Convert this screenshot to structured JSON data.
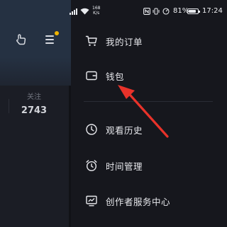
{
  "status_bar": {
    "network_speed_value": "168",
    "network_speed_unit": "K/s",
    "battery_percent": "81%",
    "battery_level": 0.81,
    "time": "17:24",
    "icons": [
      "signal-icon",
      "wifi-icon",
      "nfc-icon",
      "vibrate-icon",
      "data-saver-icon",
      "battery-icon"
    ]
  },
  "background_page": {
    "follow_label": "关注",
    "follow_count": "2743",
    "notification_dot_color": "#f0b400"
  },
  "drawer": {
    "items": [
      {
        "label": "我的订单",
        "icon": "cart-icon"
      },
      {
        "label": "钱包",
        "icon": "wallet-icon"
      },
      {
        "label": "观看历史",
        "icon": "clock-icon"
      },
      {
        "label": "时间管理",
        "icon": "alarm-clock-icon"
      },
      {
        "label": "创作者服务中心",
        "icon": "chart-board-icon"
      }
    ]
  },
  "annotation": {
    "arrow_color": "#e8322a"
  }
}
